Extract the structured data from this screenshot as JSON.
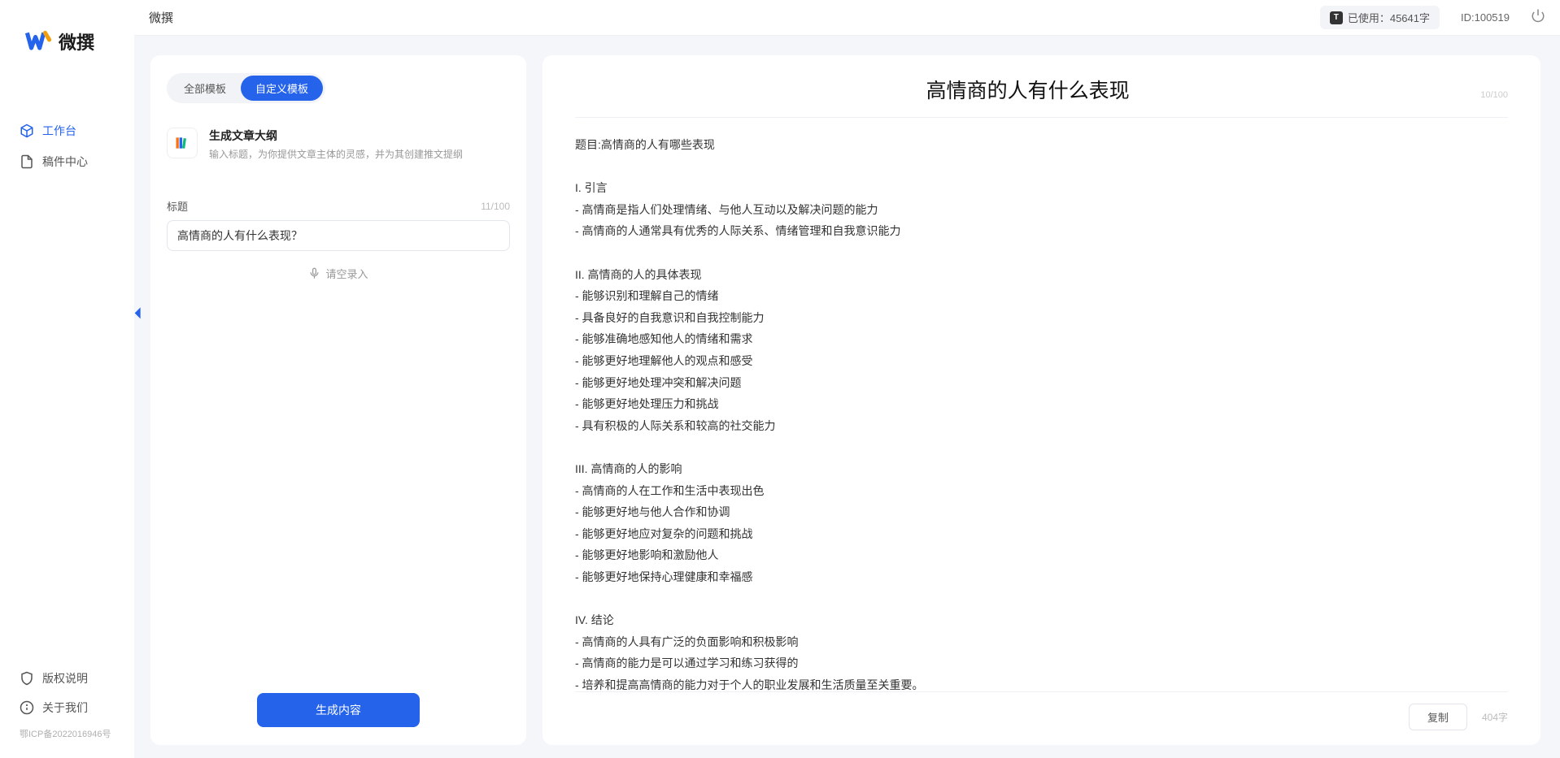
{
  "sidebar": {
    "logo_text": "微撰",
    "nav": [
      {
        "label": "工作台",
        "active": true
      },
      {
        "label": "稿件中心",
        "active": false
      }
    ],
    "bottom_nav": [
      {
        "label": "版权说明"
      },
      {
        "label": "关于我们"
      }
    ],
    "icp": "鄂ICP备2022016946号"
  },
  "topbar": {
    "app_title": "微撰",
    "usage_badge_icon": "T",
    "usage_label": "已使用：45641字",
    "user_id": "ID:100519"
  },
  "left_panel": {
    "tabs": [
      {
        "label": "全部模板",
        "active": false
      },
      {
        "label": "自定义模板",
        "active": true
      }
    ],
    "template": {
      "title": "生成文章大纲",
      "desc": "输入标题，为你提供文章主体的灵感，并为其创建推文提纲"
    },
    "field_label": "标题",
    "field_counter": "11/100",
    "title_value": "高情商的人有什么表现？",
    "voice_hint": "请空录入",
    "generate_btn": "生成内容"
  },
  "output": {
    "title": "高情商的人有什么表现",
    "title_counter": "10/100",
    "body": "题目:高情商的人有哪些表现\n\nI. 引言\n- 高情商是指人们处理情绪、与他人互动以及解决问题的能力\n- 高情商的人通常具有优秀的人际关系、情绪管理和自我意识能力\n\nII. 高情商的人的具体表现\n- 能够识别和理解自己的情绪\n- 具备良好的自我意识和自我控制能力\n- 能够准确地感知他人的情绪和需求\n- 能够更好地理解他人的观点和感受\n- 能够更好地处理冲突和解决问题\n- 能够更好地处理压力和挑战\n- 具有积极的人际关系和较高的社交能力\n\nIII. 高情商的人的影响\n- 高情商的人在工作和生活中表现出色\n- 能够更好地与他人合作和协调\n- 能够更好地应对复杂的问题和挑战\n- 能够更好地影响和激励他人\n- 能够更好地保持心理健康和幸福感\n\nIV. 结论\n- 高情商的人具有广泛的负面影响和积极影响\n- 高情商的能力是可以通过学习和练习获得的\n- 培养和提高高情商的能力对于个人的职业发展和生活质量至关重要。",
    "copy_btn": "复制",
    "word_count": "404字"
  }
}
